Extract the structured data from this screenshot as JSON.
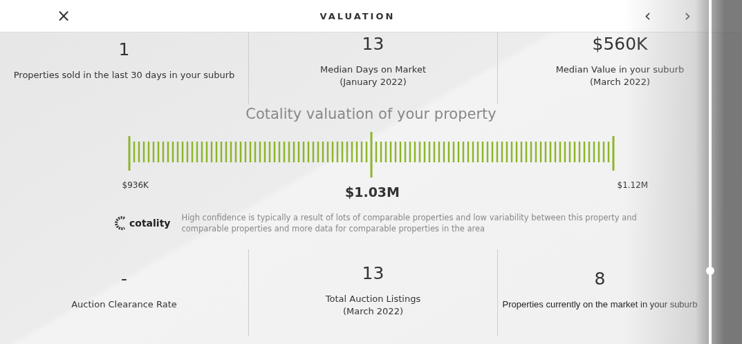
{
  "header": {
    "close": "×",
    "title": "VALUATION",
    "prev": "‹",
    "next": "›"
  },
  "top_stats": [
    {
      "value": "1",
      "label": "Properties sold in the last 30 days in your suburb"
    },
    {
      "value": "13",
      "label": "Median Days on Market\n(January 2022)"
    },
    {
      "value": "$560K",
      "label": "Median Value in your suburb\n(March 2022)"
    }
  ],
  "valuation": {
    "title": "Cotality valuation of your property",
    "low": "$936K",
    "estimate": "$1.03M",
    "high": "$1.12M",
    "level": 0.5
  },
  "confidence": {
    "brand": "cotality",
    "text": "High confidence is typically a result of lots of comparable properties and low variability between this property and comparable properties and more data for comparable properties in the area"
  },
  "bottom_stats": [
    {
      "value": "-",
      "label": "Auction Clearance Rate"
    },
    {
      "value": "13",
      "label": "Total Auction Listings\n(March 2022)"
    },
    {
      "value": "8",
      "label": "Properties currently on the market in your suburb"
    }
  ]
}
